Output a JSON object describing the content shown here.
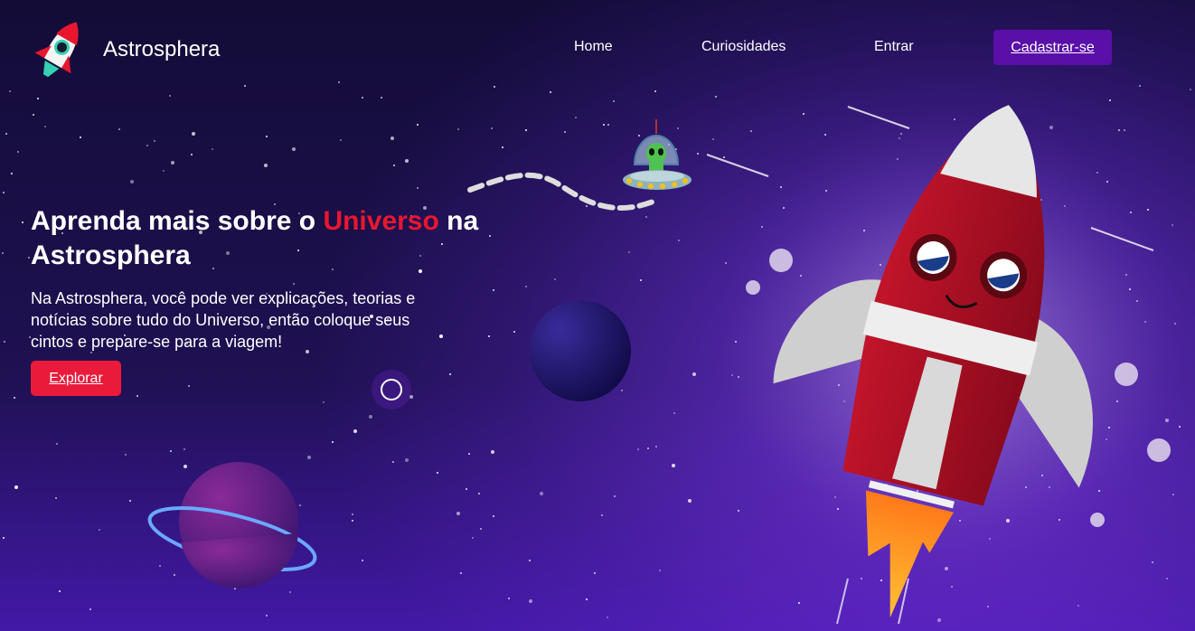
{
  "header": {
    "brand": "Astrosphera",
    "nav": [
      "Home",
      "Curiosidades",
      "Entrar"
    ],
    "cta_label": "Cadastrar-se"
  },
  "hero": {
    "title_pre": "Aprenda mais sobre o ",
    "title_highlight": "Universo",
    "title_post": " na Astrosphera",
    "description": "Na Astrosphera, você pode ver explicações, teorias e notícias sobre tudo do Universo, então coloque seus cintos e prepare-se para a viagem!",
    "button_label": "Explorar"
  },
  "colors": {
    "accent_red": "#e8172f",
    "cta_purple": "#5a0fa8"
  },
  "icons": [
    "rocket-logo-icon",
    "alien-ufo-icon",
    "planet-icon",
    "ringed-planet-icon",
    "rocket-illustration"
  ]
}
